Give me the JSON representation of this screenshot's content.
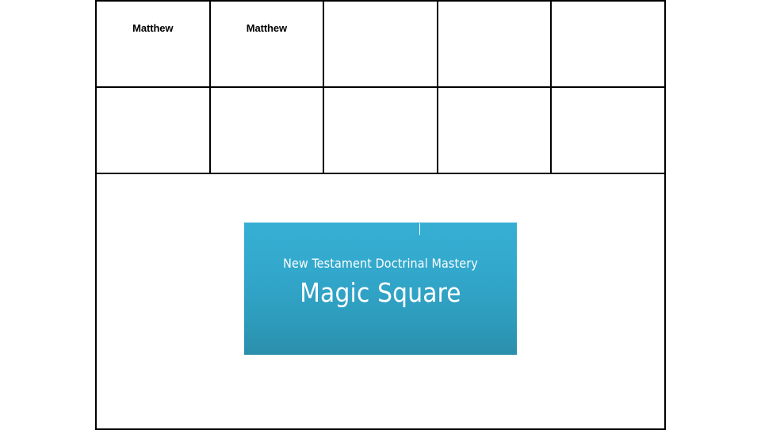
{
  "slide": {
    "background_color": "#FFFFFF",
    "table": {
      "border_color": "#000000",
      "columns": 5,
      "rows": [
        {
          "type": "grid-row",
          "cells": [
            "Matthew",
            "Matthew",
            "",
            "",
            ""
          ]
        },
        {
          "type": "grid-row",
          "cells": [
            "",
            "",
            "",
            "",
            ""
          ]
        }
      ],
      "footer_row": {
        "type": "wide-row",
        "cells": [
          ""
        ]
      }
    },
    "title_block": {
      "subtitle": "New Testament Doctrinal Mastery",
      "title": "Magic Square",
      "text_color": "#FFFFFF",
      "gradient_top": "#36AFD4",
      "gradient_bottom": "#2B8FAC",
      "cursor_visible": true
    }
  }
}
